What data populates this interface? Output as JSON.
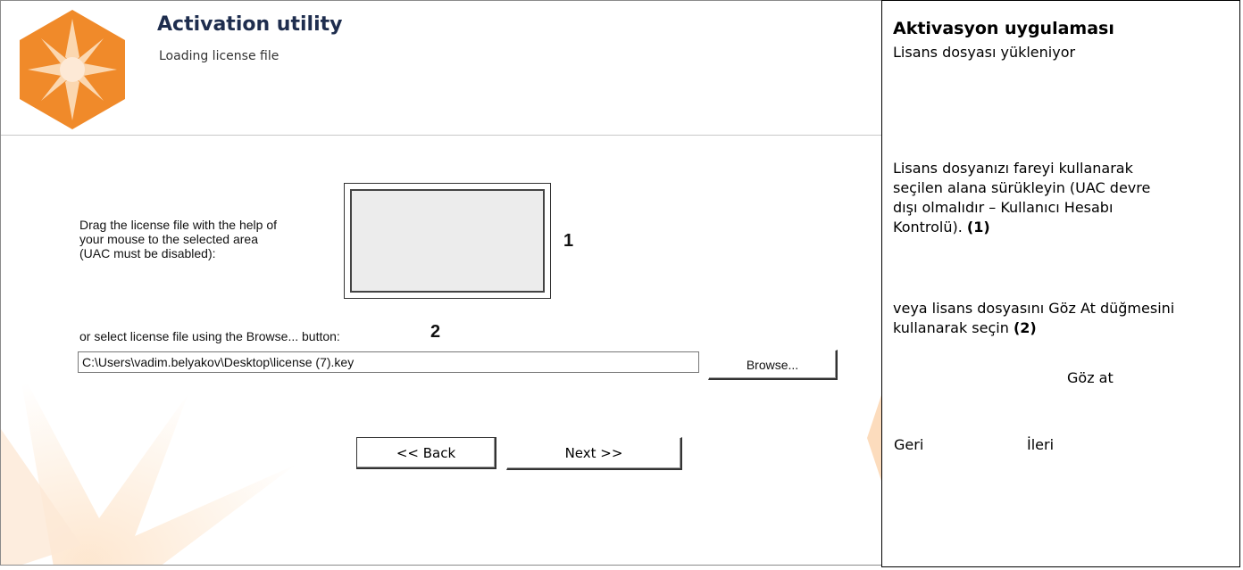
{
  "window": {
    "title": "Activation utility",
    "subtitle": "Loading license file"
  },
  "main": {
    "drag_instruction_lines": [
      "Drag the license file with the help of",
      "your mouse to the selected area",
      "(UAC must be disabled):"
    ],
    "marker_1": "1",
    "browse_instruction": "or select license file using the Browse... button:",
    "marker_2": "2",
    "license_path_value": "C:\\Users\\vadim.belyakov\\Desktop\\license (7).key",
    "browse_button_label": "Browse...",
    "back_button_label": "<< Back",
    "next_button_label": "Next >>"
  },
  "translation": {
    "title": "Aktivasyon uygulaması",
    "subtitle": "Lisans dosyası yükleniyor",
    "instruction_text": "Lisans dosyanızı fareyi kullanarak seçilen alana sürükleyin (UAC devre dışı olmalıdır – Kullanıcı Hesabı Kontrolü).",
    "instruction_marker": "(1)",
    "browse_text": "veya lisans dosyasını Göz At düğmesini kullanarak seçin",
    "browse_marker": "(2)",
    "browse_button": "Göz at",
    "back": "Geri",
    "next": "İleri"
  },
  "colors": {
    "logo_orange": "#f08a2a",
    "logo_light": "#fbd7b0",
    "title_navy": "#1e2d4e"
  },
  "icons": {
    "logo": "orange-star-hexagon-logo"
  }
}
